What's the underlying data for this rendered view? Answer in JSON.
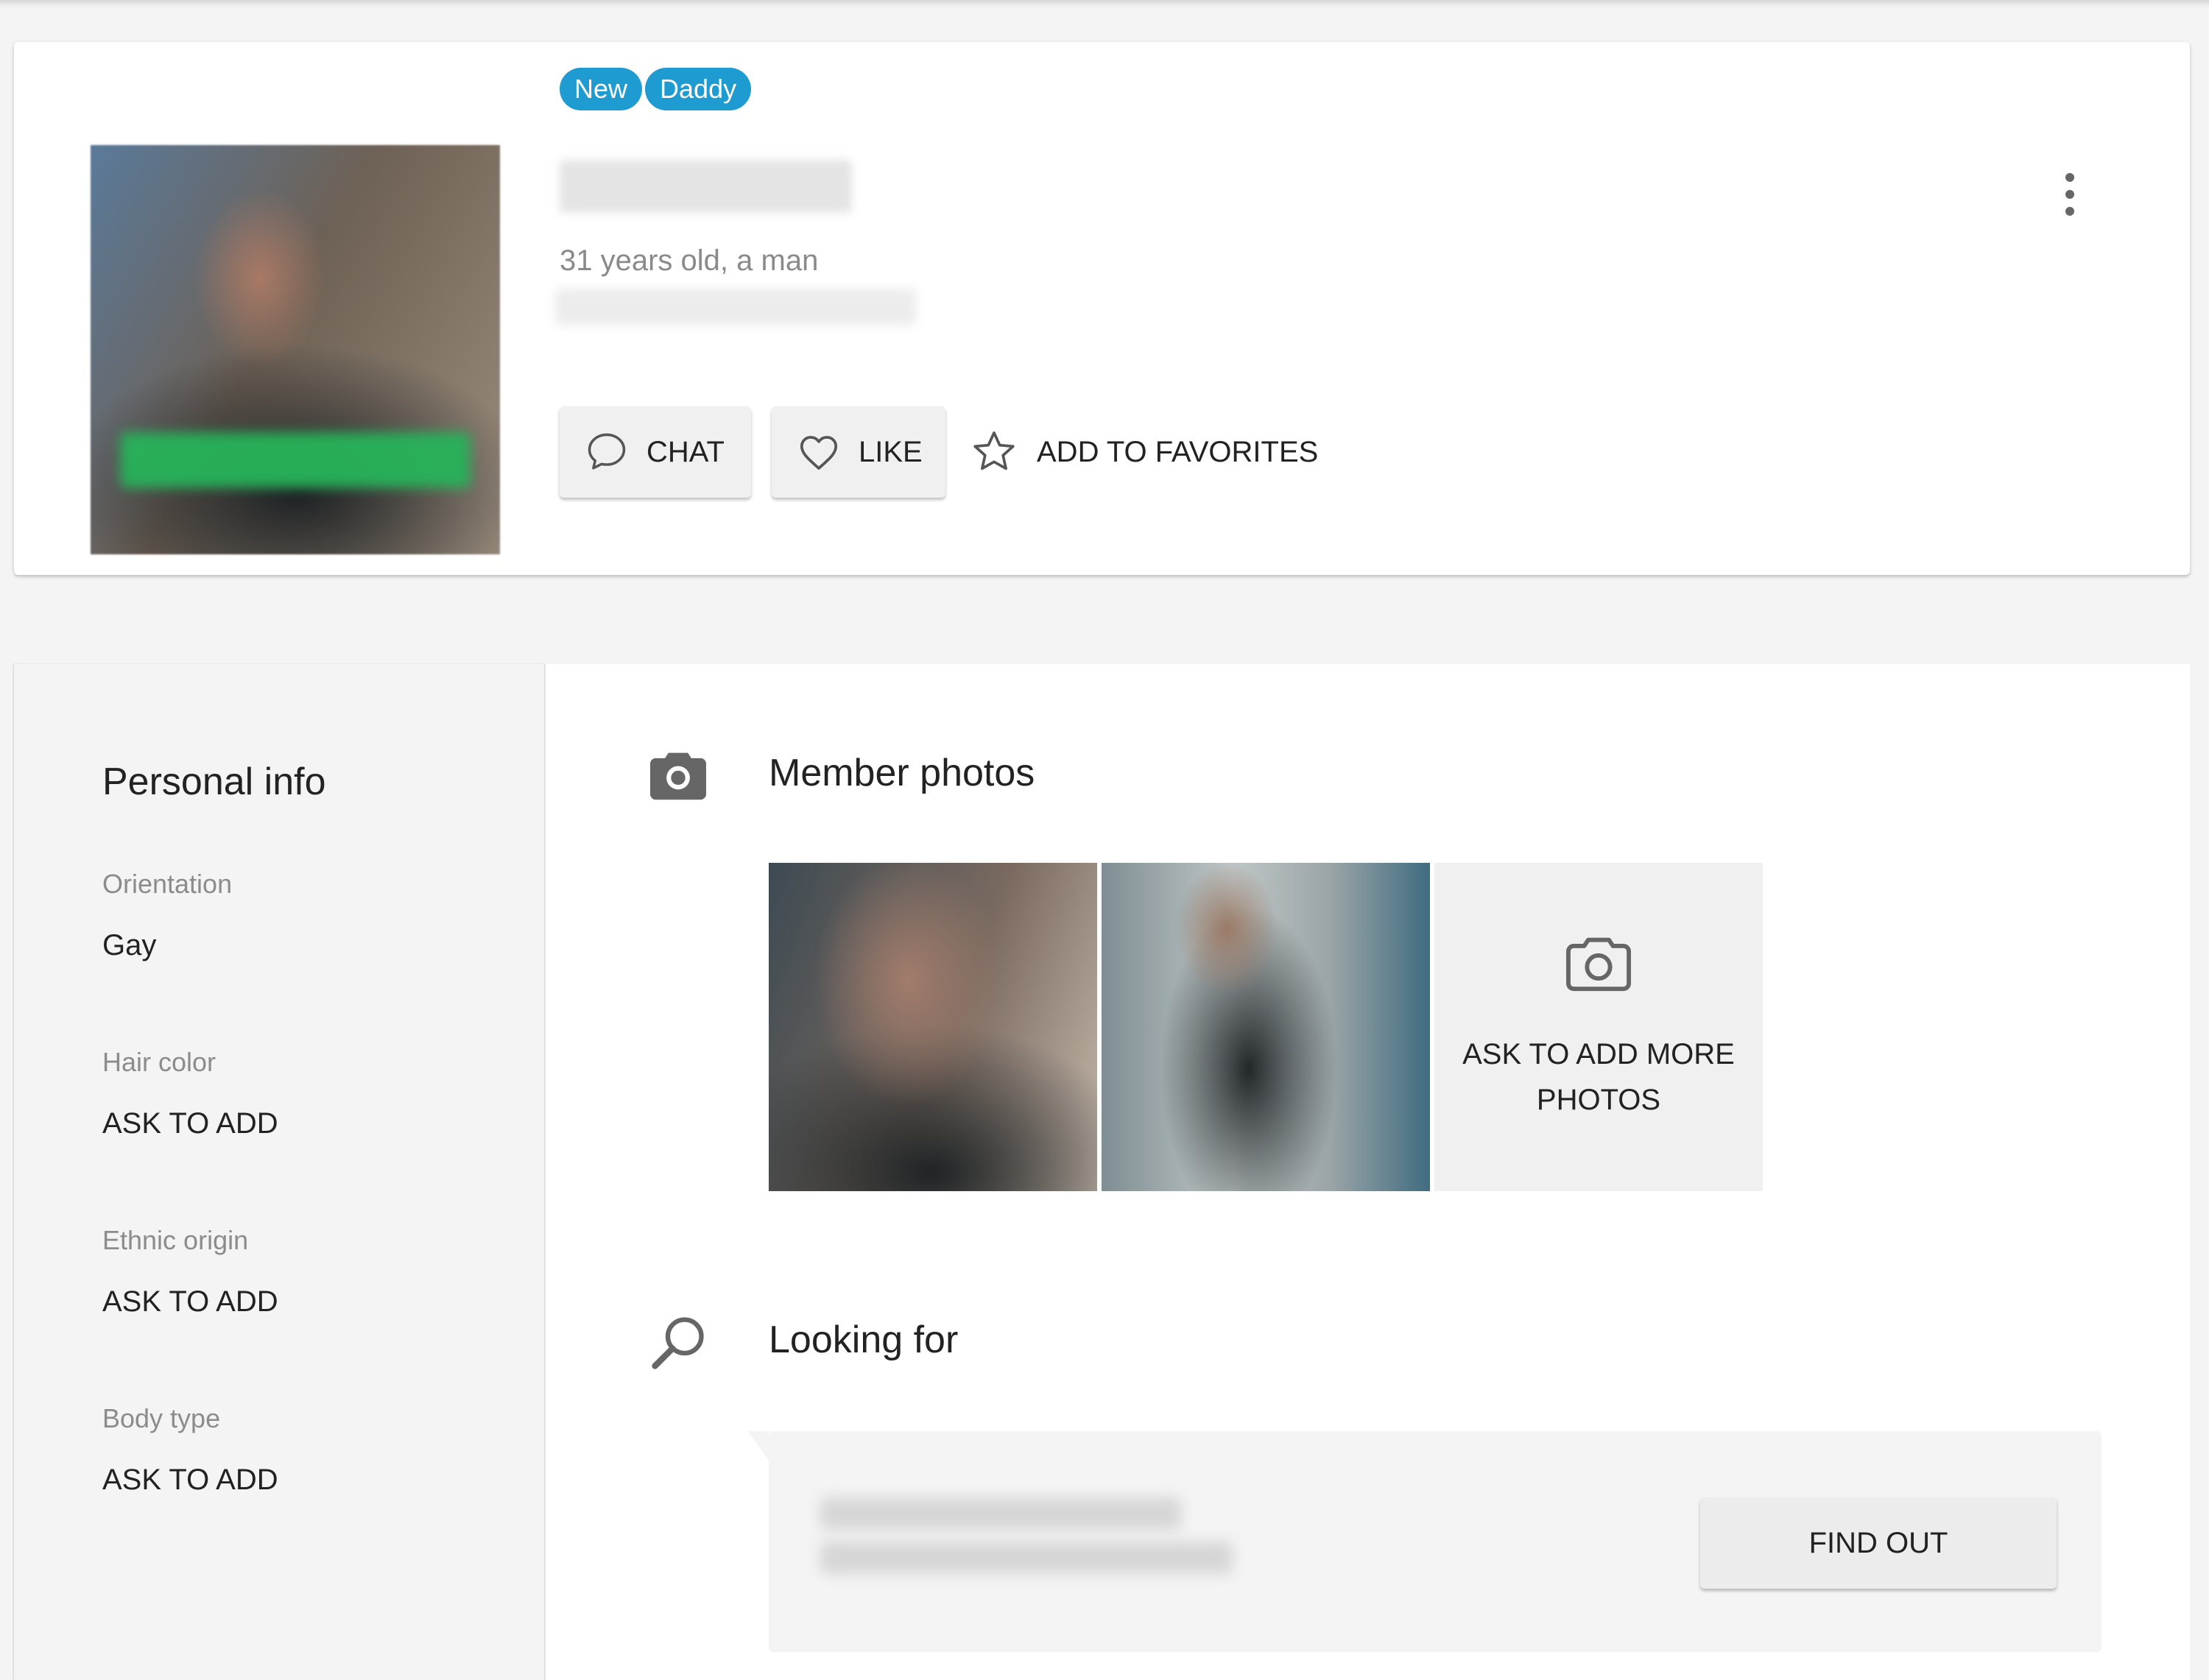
{
  "profile": {
    "badges": [
      "New",
      "Daddy"
    ],
    "age_text": "31 years old, a man",
    "actions": {
      "chat_label": "CHAT",
      "like_label": "LIKE",
      "favorites_label": "ADD TO FAVORITES"
    }
  },
  "personal_info": {
    "title": "Personal info",
    "items": [
      {
        "label": "Orientation",
        "value": "Gay"
      },
      {
        "label": "Hair color",
        "value": "ASK TO ADD"
      },
      {
        "label": "Ethnic origin",
        "value": "ASK TO ADD"
      },
      {
        "label": "Body type",
        "value": "ASK TO ADD"
      }
    ]
  },
  "member_photos": {
    "title": "Member photos",
    "ask_more_label": "ASK TO ADD MORE PHOTOS"
  },
  "looking_for": {
    "title": "Looking for",
    "find_out_label": "FIND OUT"
  },
  "colors": {
    "badge": "#1e9bd0",
    "page_background": "#f4f4f4"
  }
}
